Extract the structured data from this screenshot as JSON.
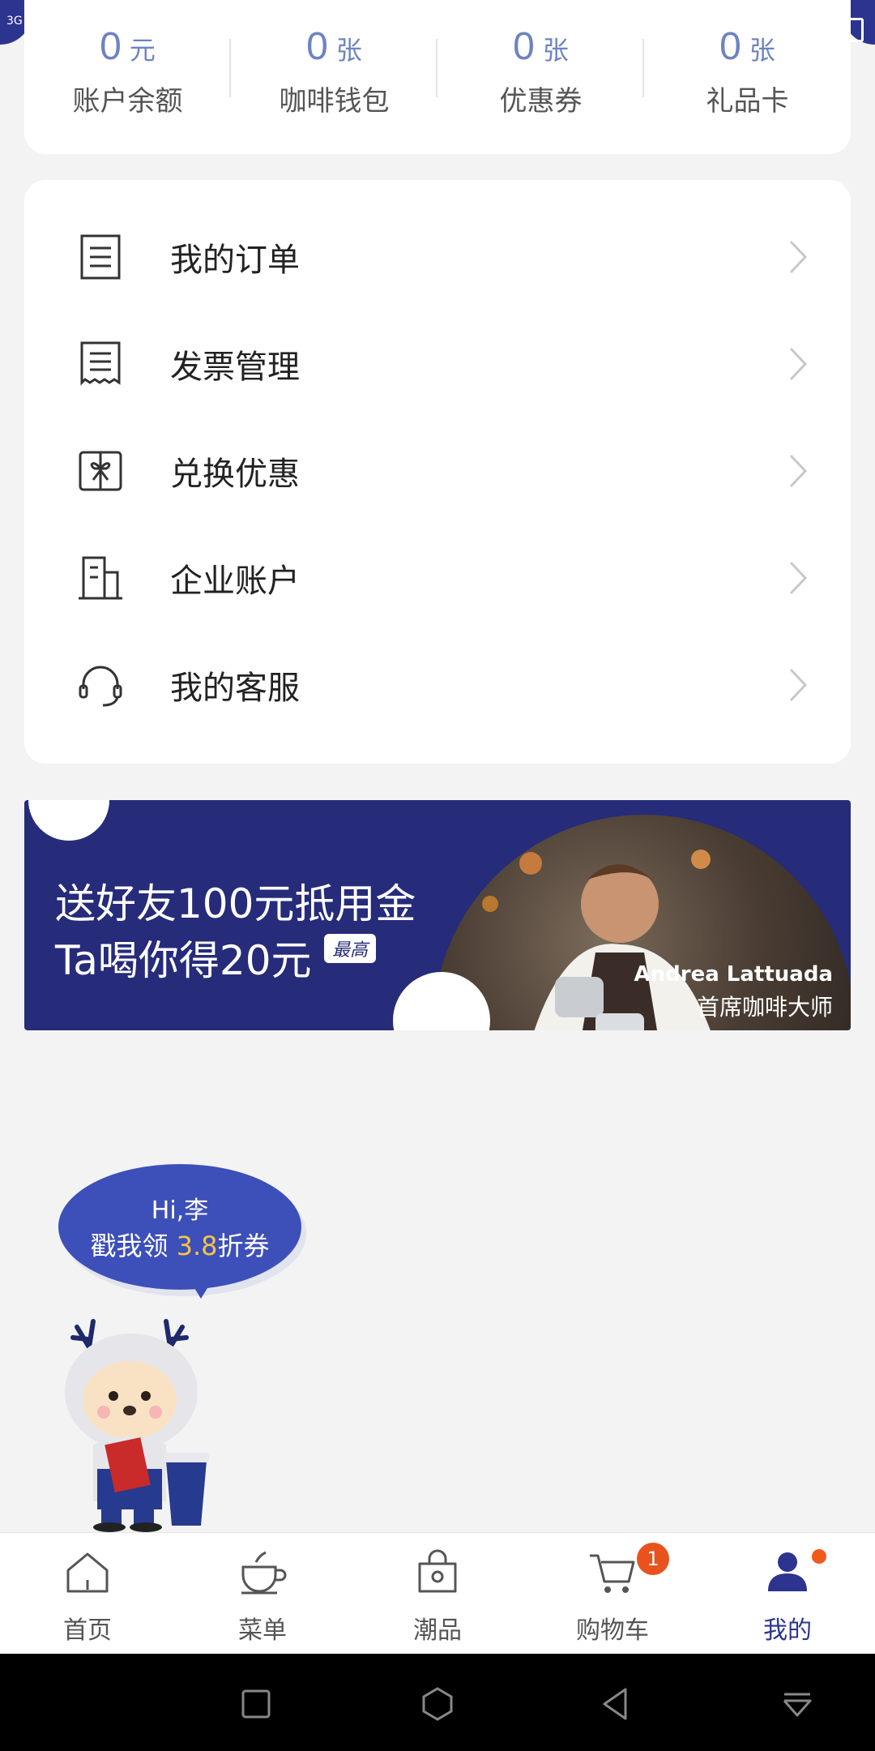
{
  "stats": [
    {
      "value": "0",
      "unit": "元",
      "label": "账户余额"
    },
    {
      "value": "0",
      "unit": "张",
      "label": "咖啡钱包"
    },
    {
      "value": "0",
      "unit": "张",
      "label": "优惠券"
    },
    {
      "value": "0",
      "unit": "张",
      "label": "礼品卡"
    }
  ],
  "menu": [
    {
      "label": "我的订单",
      "icon": "order-list-icon"
    },
    {
      "label": "发票管理",
      "icon": "invoice-icon"
    },
    {
      "label": "兑换优惠",
      "icon": "gift-redeem-icon"
    },
    {
      "label": "企业账户",
      "icon": "building-icon"
    },
    {
      "label": "我的客服",
      "icon": "headset-icon"
    }
  ],
  "banner": {
    "line1": "送好友100元抵用金",
    "line2": "Ta喝你得20元",
    "tag": "最高",
    "person_name": "Andrea Lattuada",
    "person_title": "首席咖啡大师"
  },
  "bubble": {
    "greeting": "Hi,李",
    "prefix": "戳我领",
    "highlight": "3.8",
    "suffix": "折券"
  },
  "tabs": [
    {
      "label": "首页",
      "icon": "home-icon"
    },
    {
      "label": "菜单",
      "icon": "coffee-cup-icon"
    },
    {
      "label": "潮品",
      "icon": "shopping-bag-icon"
    },
    {
      "label": "购物车",
      "icon": "cart-icon",
      "badge": "1"
    },
    {
      "label": "我的",
      "icon": "user-icon",
      "active": true
    }
  ],
  "status_bar": {
    "network": "3G"
  },
  "colors": {
    "brand": "#2c3490",
    "accent_num": "#6d83c2",
    "badge": "#e8531d",
    "highlight": "#f6c445"
  }
}
